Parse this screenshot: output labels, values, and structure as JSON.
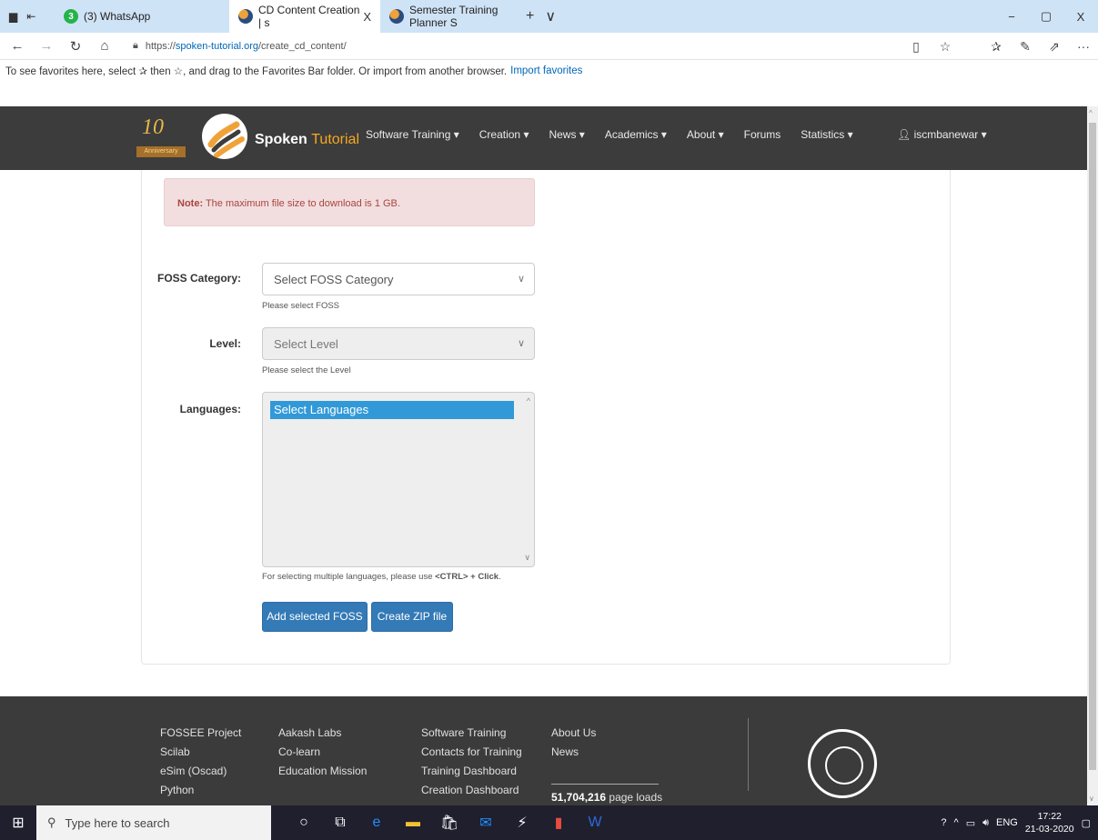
{
  "browser": {
    "tabs": [
      {
        "label": "(3) WhatsApp",
        "badge": "3"
      },
      {
        "label": "CD Content Creation | s",
        "close": "X"
      },
      {
        "label": "Semester Training Planner S"
      }
    ],
    "new_tab": "+",
    "tab_list": "∨",
    "window_controls": [
      "−",
      "▢",
      "X"
    ],
    "url": "https://",
    "url_host": "spoken-tutorial.org",
    "url_path": "/create_cd_content/",
    "favorites_hint": "To see favorites here, select ✰ then ☆, and drag to the Favorites Bar folder. Or import from another browser.",
    "import_favorites": "Import favorites"
  },
  "site": {
    "anniversary": "10",
    "anniversary_ribbon": "Anniversary",
    "brand_part1": "Spoken",
    "brand_part2": "Tutorial",
    "menu": [
      "Software Training ▾",
      "Creation ▾",
      "News ▾",
      "Academics ▾",
      "About ▾",
      "Forums",
      "Statistics ▾"
    ],
    "user": "iscmbanewar ▾"
  },
  "form": {
    "note_label": "Note:",
    "note_text": " The maximum file size to download is 1 GB.",
    "foss_label": "FOSS Category:",
    "foss_value": "Select FOSS Category",
    "foss_help": "Please select FOSS",
    "level_label": "Level:",
    "level_value": "Select Level",
    "level_help": "Please select the Level",
    "languages_label": "Languages:",
    "languages_option": "Select Languages",
    "languages_help_pre": "For selecting multiple languages, please use ",
    "languages_help_bold": "<CTRL> + Click",
    "languages_help_post": ".",
    "add_button": "Add selected FOSS",
    "zip_button": "Create ZIP file"
  },
  "footer": {
    "col1": [
      "FOSSEE Project",
      "Scilab",
      "eSim (Oscad)",
      "Python"
    ],
    "col2": [
      "Aakash Labs",
      "Co-learn",
      "Education Mission"
    ],
    "col3": [
      "Software Training",
      "Contacts for Training",
      "Training Dashboard",
      "Creation Dashboard"
    ],
    "col4": [
      "About Us",
      "News"
    ],
    "page_loads_value": "51,704,216",
    "page_loads_label": " page loads"
  },
  "taskbar": {
    "search_placeholder": "Type here to search",
    "lang": "ENG",
    "time": "17:22",
    "date": "21-03-2020"
  }
}
